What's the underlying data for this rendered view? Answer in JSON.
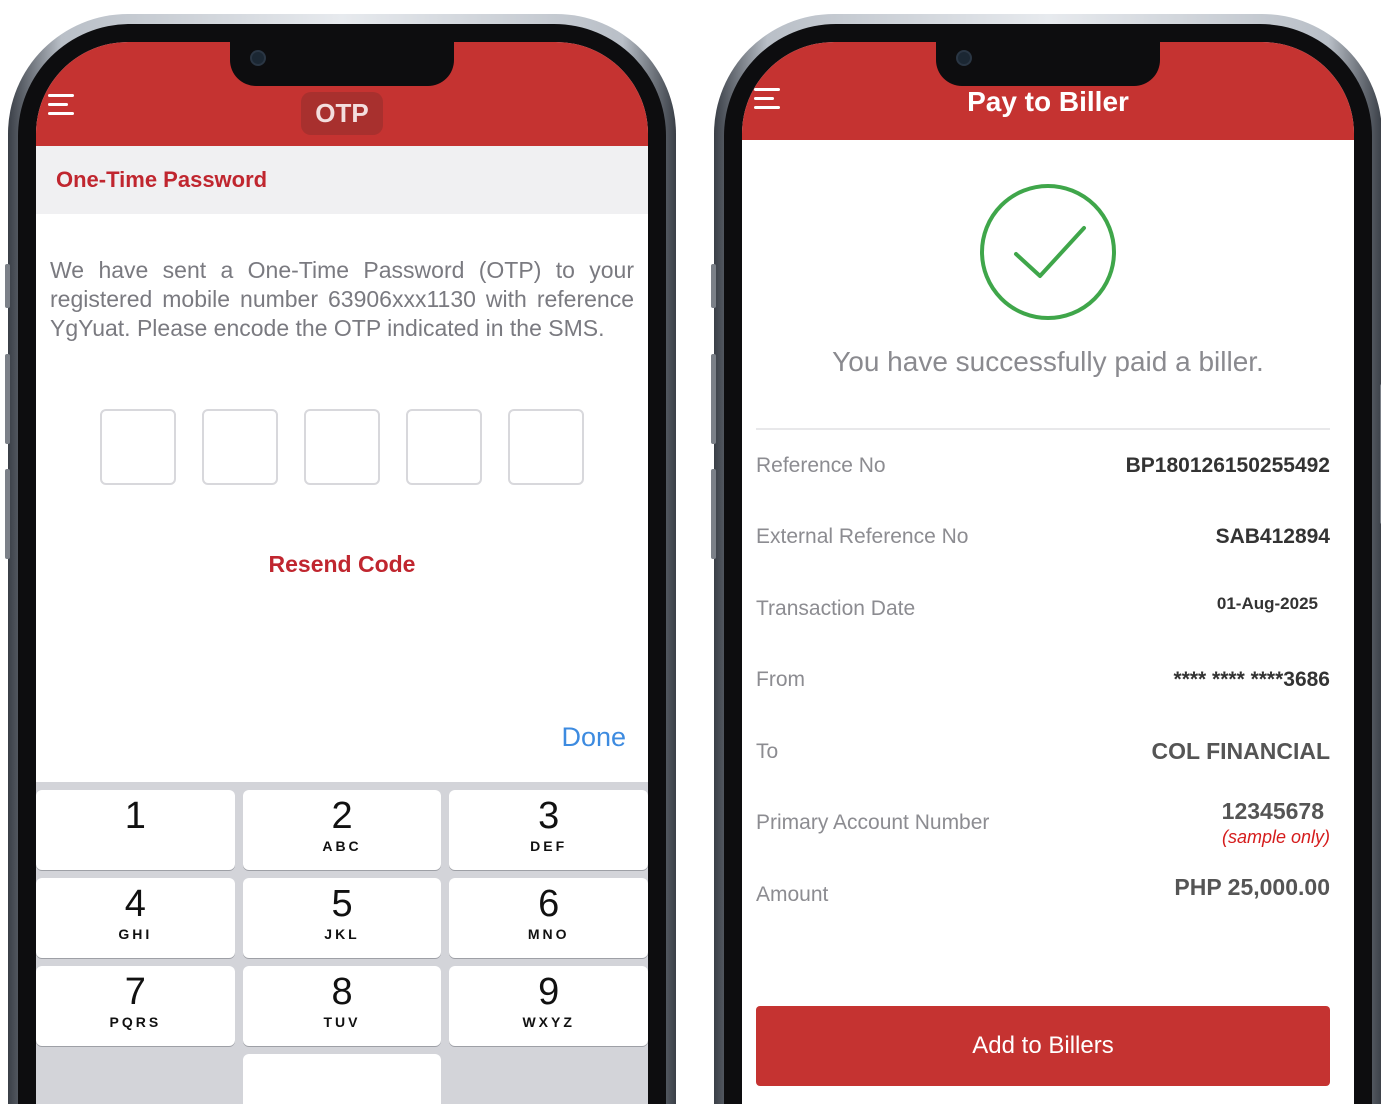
{
  "left_screen": {
    "appbar_title": "OTP",
    "section_title": "One-Time Password",
    "message": "We have sent a One-Time Password (OTP) to your registered mobile number 63906xxx1130 with reference YgYuat. Please encode the OTP indicated in the SMS.",
    "resend_label": "Resend Code",
    "done_label": "Done",
    "keypad": [
      {
        "num": "1",
        "letters": ""
      },
      {
        "num": "2",
        "letters": "ABC"
      },
      {
        "num": "3",
        "letters": "DEF"
      },
      {
        "num": "4",
        "letters": "GHI"
      },
      {
        "num": "5",
        "letters": "JKL"
      },
      {
        "num": "6",
        "letters": "MNO"
      },
      {
        "num": "7",
        "letters": "PQRS"
      },
      {
        "num": "8",
        "letters": "TUV"
      },
      {
        "num": "9",
        "letters": "WXYZ"
      }
    ]
  },
  "right_screen": {
    "appbar_title": "Pay to Biller",
    "success_message": "You have successfully paid a biller.",
    "details": {
      "reference_no": {
        "label": "Reference No",
        "value": "BP180126150255492"
      },
      "external_reference_no": {
        "label": "External Reference No",
        "value": "SAB412894"
      },
      "transaction_date": {
        "label": "Transaction Date",
        "value": "01-Aug-2025"
      },
      "from": {
        "label": "From",
        "value": "**** **** ****3686"
      },
      "to": {
        "label": "To",
        "value": "COL FINANCIAL"
      },
      "primary_account_number": {
        "label": "Primary Account Number",
        "value": "12345678",
        "note": "(sample only)"
      },
      "amount": {
        "label": "Amount",
        "value": "PHP 25,000.00"
      }
    },
    "add_button_label": "Add to Billers"
  },
  "colors": {
    "brand_red": "#c53331",
    "success_green": "#3fa64a",
    "done_blue": "#3d8be0"
  }
}
